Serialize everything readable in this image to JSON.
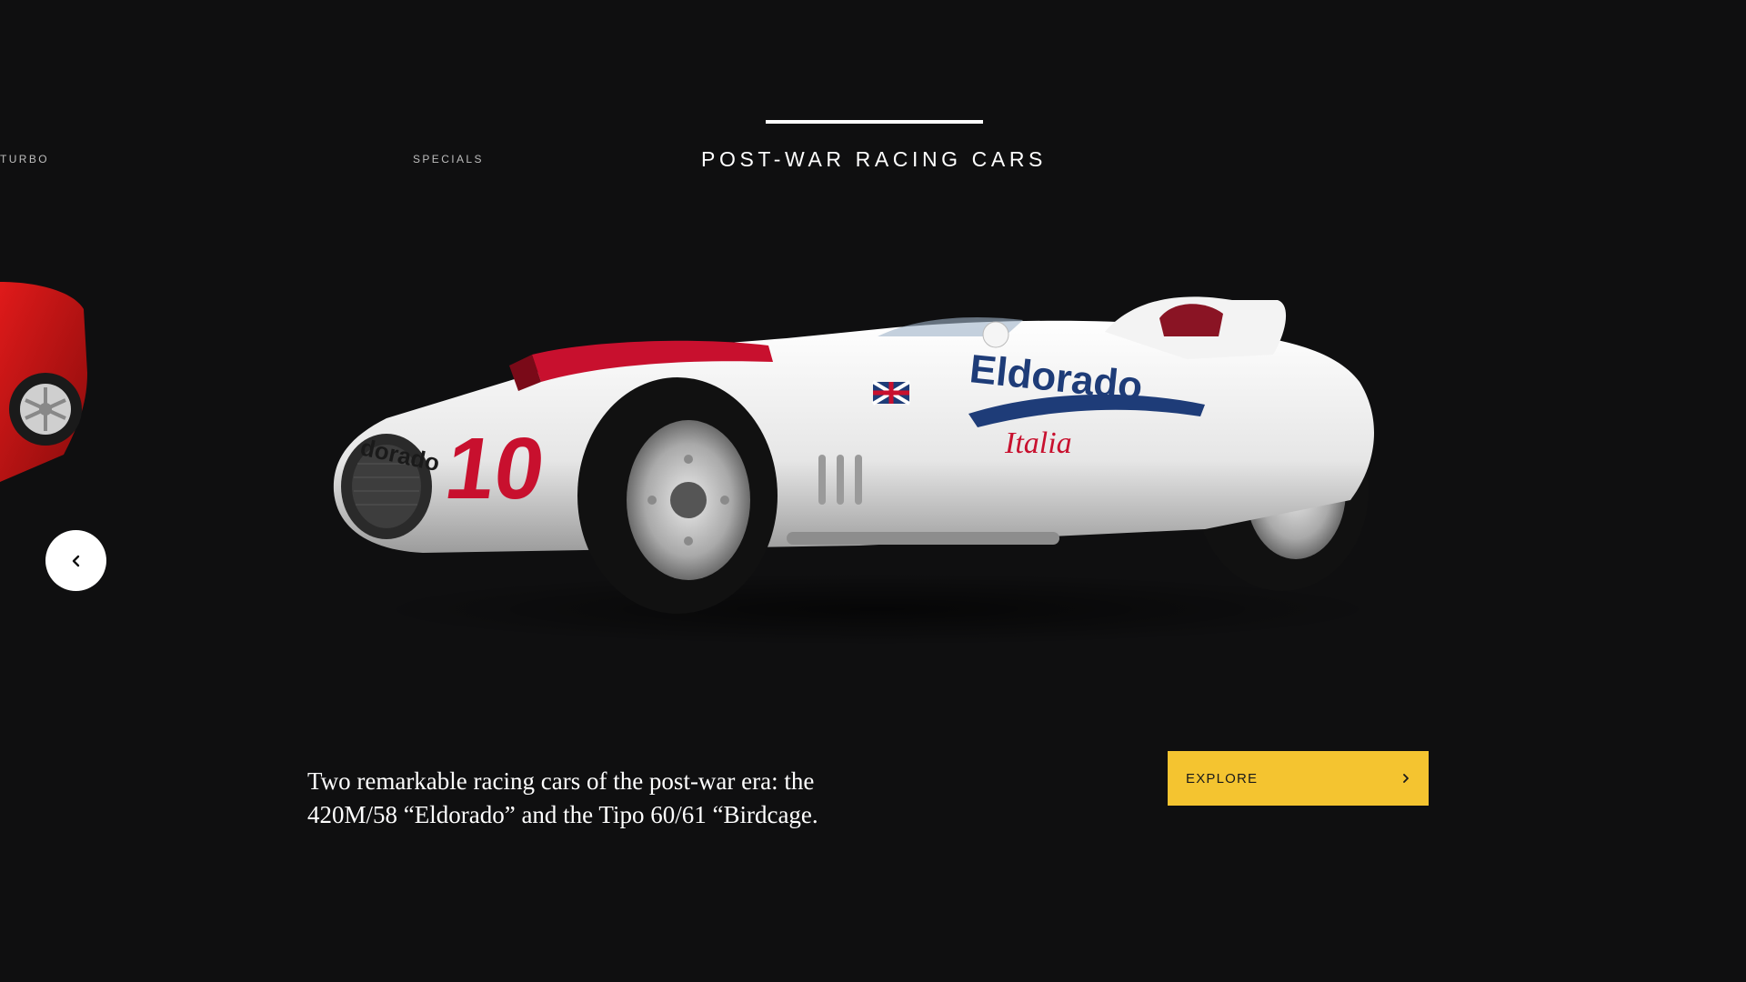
{
  "tabs": {
    "left_partial": "TURBO",
    "specials": "SPECIALS",
    "active": "POST-WAR RACING CARS"
  },
  "car": {
    "number": "10",
    "livery_text": "Eldorado",
    "nose_text": "dorado",
    "side_text": "Italia"
  },
  "description": "Two remarkable racing cars of the post-war era: the 420M/58 “Eldorado” and the Tipo 60/61 “Birdcage.",
  "explore": {
    "label": "EXPLORE"
  },
  "icons": {
    "prev": "chevron-left-icon",
    "explore_arrow": "chevron-right-icon"
  },
  "colors": {
    "background": "#0f0f10",
    "accent": "#f4c430",
    "car_red": "#c8102e",
    "text": "#ffffff"
  }
}
